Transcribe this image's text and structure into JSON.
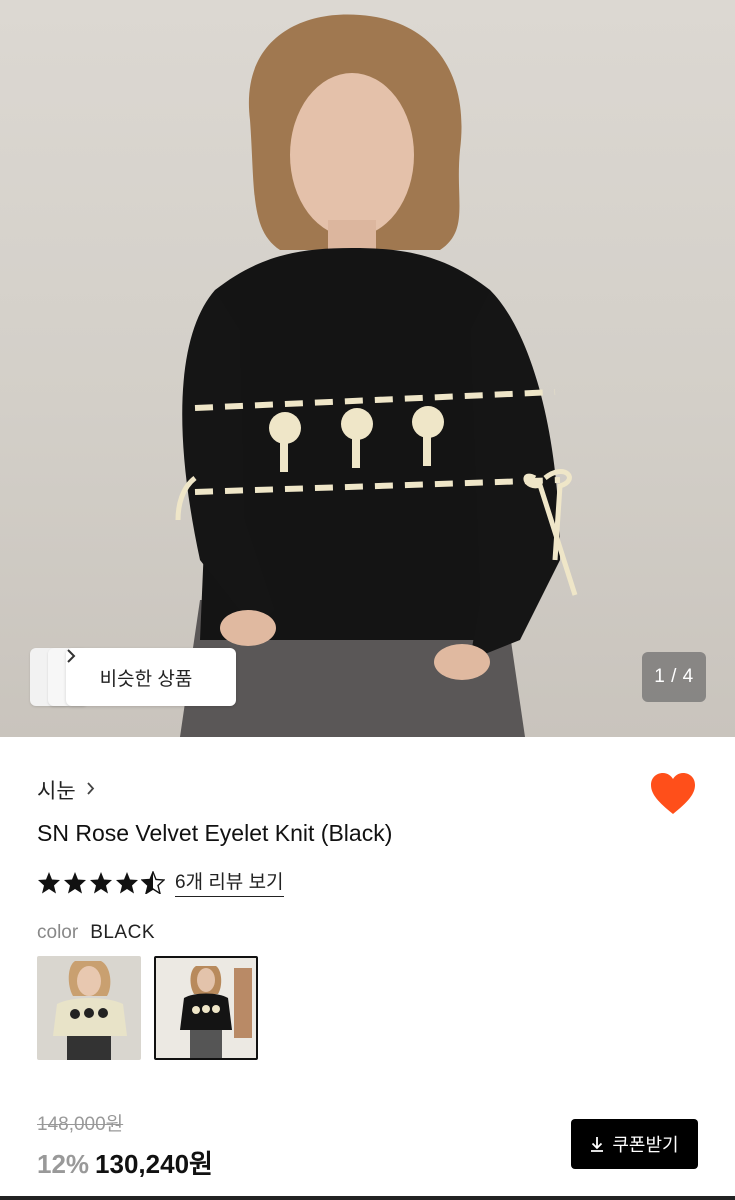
{
  "hero": {
    "similar_button_label": "비슷한 상품",
    "page_indicator": "1 / 4",
    "icons": {
      "similar_chevron": "chevron-right-icon"
    }
  },
  "product": {
    "brand": "시눈",
    "title": "SN Rose Velvet Eyelet Knit (Black)",
    "rating": 4.5,
    "review_link": "6개 리뷰 보기",
    "liked": true,
    "color_label": "color",
    "color_value": "BLACK",
    "variants": [
      {
        "color": "cream",
        "selected": false
      },
      {
        "color": "black",
        "selected": true
      }
    ],
    "original_price": "148,000원",
    "discount": "12%",
    "price": "130,240원",
    "coupon_button": "쿠폰받기"
  },
  "colors": {
    "heart": "#ff4f1a",
    "coupon_bg": "#000000",
    "discount_text": "#999999"
  }
}
